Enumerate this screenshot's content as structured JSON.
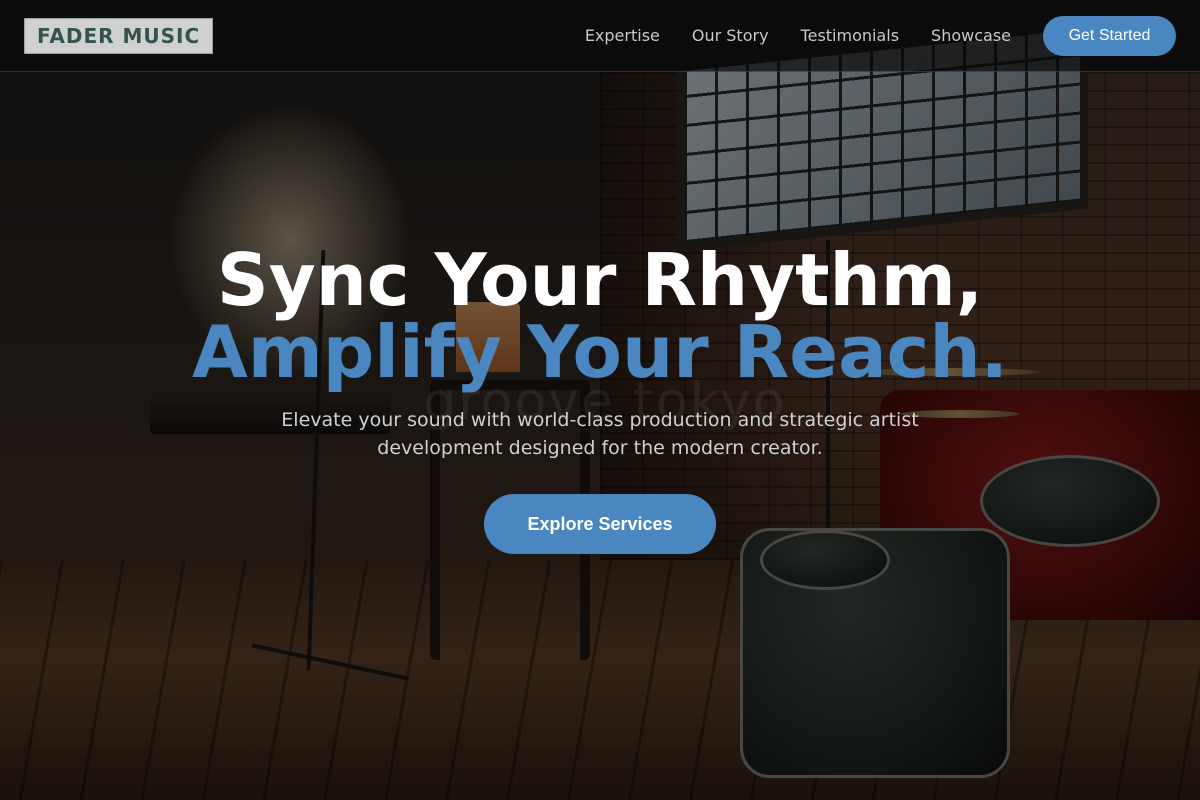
{
  "header": {
    "logo_text": "FADER MUSIC",
    "nav": [
      {
        "label": "Expertise"
      },
      {
        "label": "Our Story"
      },
      {
        "label": "Testimonials"
      },
      {
        "label": "Showcase"
      }
    ],
    "cta_label": "Get Started"
  },
  "hero": {
    "headline_line1": "Sync Your Rhythm,",
    "headline_line2": "Amplify Your Reach.",
    "subtitle": "Elevate your sound with world-class production and strategic artist development designed for the modern creator.",
    "button_label": "Explore Services",
    "background_sign_text": "groove tokyo"
  },
  "colors": {
    "accent": "#4a86bf",
    "logo_bg": "#cfd1d0",
    "logo_text": "#34534e",
    "header_bg": "#0a0a0a"
  }
}
